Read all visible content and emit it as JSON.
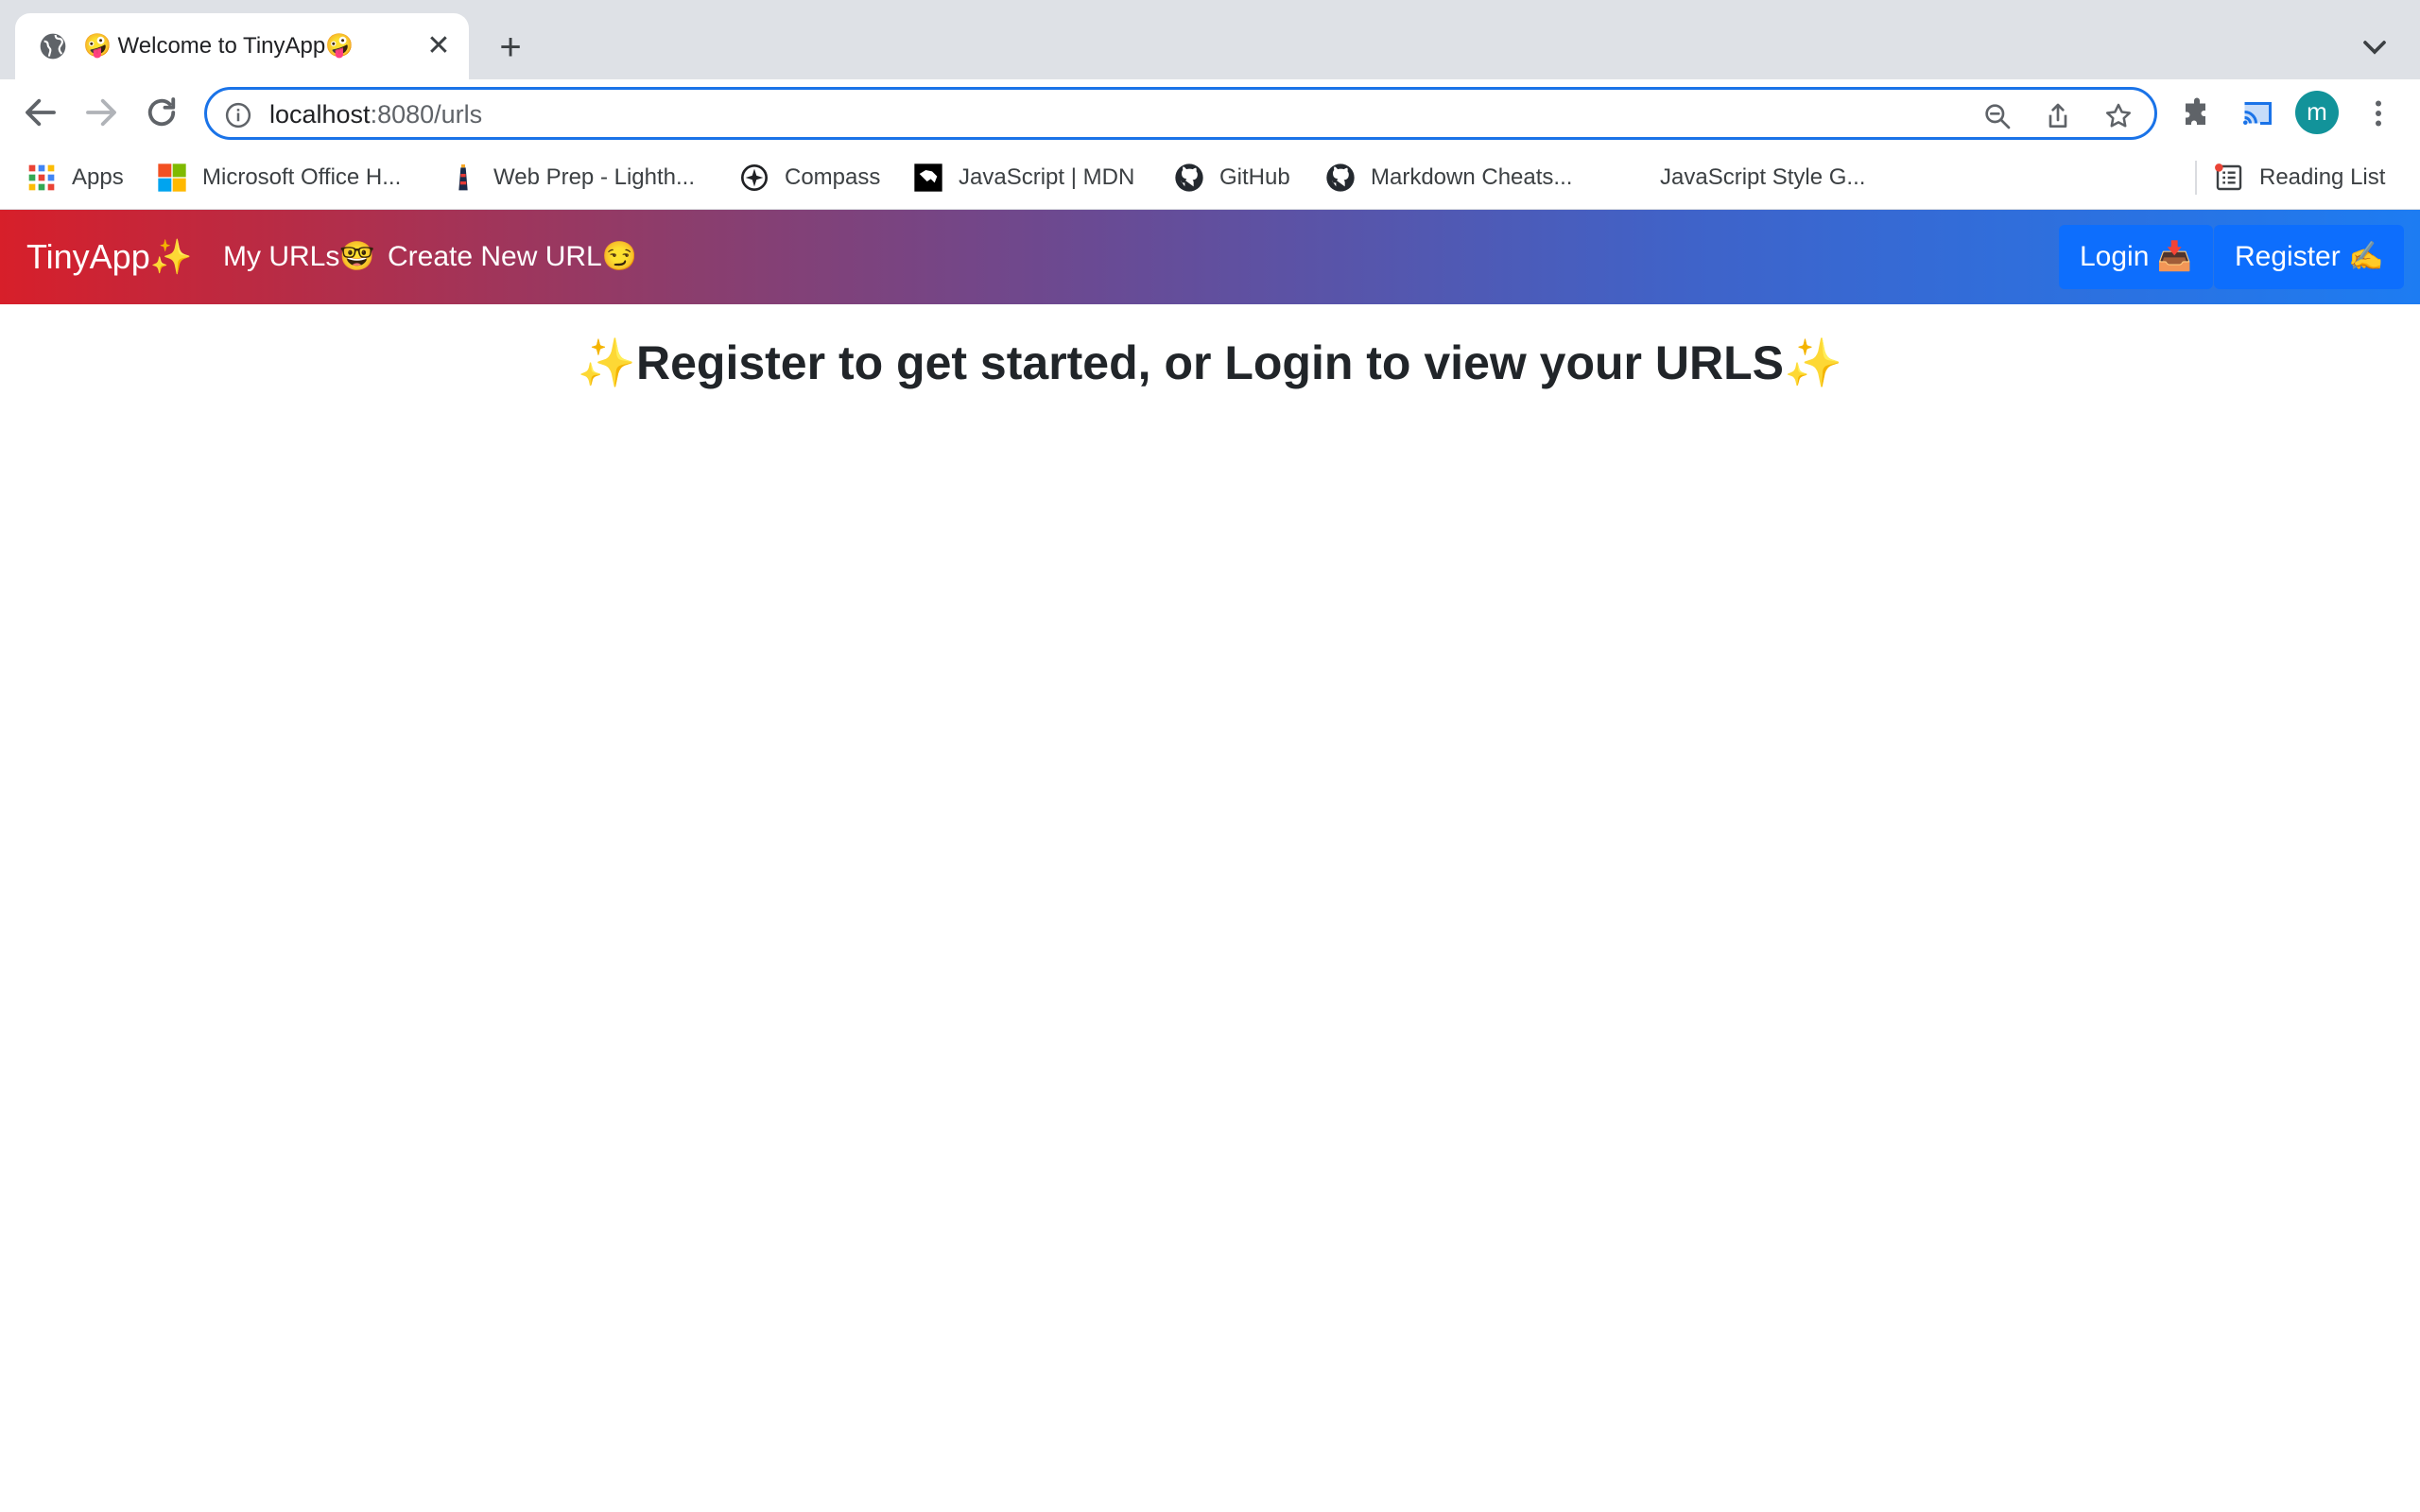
{
  "browser": {
    "tab": {
      "title": "🤪 Welcome to TinyApp🤪",
      "close": "✕"
    },
    "new_tab": "+",
    "address": {
      "host": "localhost",
      "path": ":8080/urls"
    },
    "profile_initial": "m"
  },
  "bookmarks": [
    {
      "label": "Apps",
      "icon": "apps-grid-icon"
    },
    {
      "label": "Microsoft Office H...",
      "icon": "microsoft-logo-icon"
    },
    {
      "label": "Web Prep - Lighth...",
      "icon": "lighthouse-icon"
    },
    {
      "label": "Compass",
      "icon": "compass-icon"
    },
    {
      "label": "JavaScript | MDN",
      "icon": "mdn-icon"
    },
    {
      "label": "GitHub",
      "icon": "github-icon"
    },
    {
      "label": "Markdown Cheats...",
      "icon": "github-icon"
    },
    {
      "label": "JavaScript Style G...",
      "icon": "none"
    }
  ],
  "reading_list": "Reading List",
  "navbar": {
    "brand": "TinyApp✨",
    "links": [
      "My URLs🤓",
      "Create New URL😏"
    ],
    "login": "Login 📥",
    "register": "Register ✍️"
  },
  "main": {
    "headline": "✨Register to get started, or Login to view your URLS✨"
  },
  "colors": {
    "gradient_start": "#d71f2a",
    "gradient_end": "#1d7cf2",
    "button_primary": "#0d6efd",
    "omnibox_focus": "#1a73e8"
  }
}
